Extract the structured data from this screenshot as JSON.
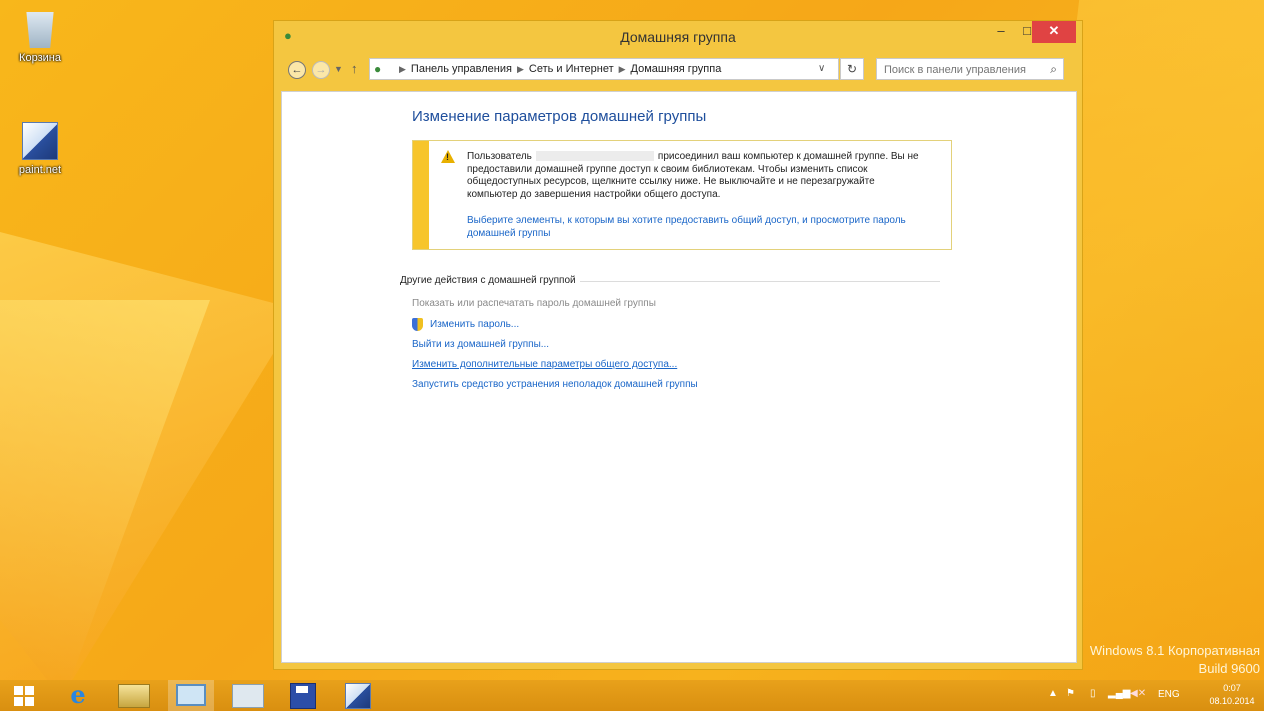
{
  "desktop": {
    "icons": [
      {
        "label": "Корзина"
      },
      {
        "label": "paint.net"
      }
    ],
    "watermark": {
      "line1": "Windows 8.1 Корпоративная",
      "line2": "Build 9600"
    }
  },
  "window": {
    "title": "Домашняя группа",
    "controls": {
      "minimize": "–",
      "maximize": "□",
      "close": "✕"
    },
    "address": {
      "breadcrumbs": [
        "Панель управления",
        "Сеть и Интернет",
        "Домашняя группа"
      ],
      "search_placeholder": "Поиск в панели управления"
    },
    "content": {
      "title": "Изменение параметров домашней группы",
      "notice": {
        "text_before": "Пользователь",
        "text_after": "присоединил ваш компьютер к домашней группе. Вы не предоставили домашней группе доступ к своим библиотекам. Чтобы изменить список общедоступных ресурсов, щелкните ссылку ниже. Не выключайте и не перезагружайте компьютер до завершения настройки общего доступа.",
        "link": "Выберите элементы, к которым вы хотите предоставить общий доступ, и просмотрите пароль домашней группы"
      },
      "other_actions": {
        "heading": "Другие действия с домашней группой",
        "show_password": "Показать или распечатать пароль домашней группы",
        "change_password": "Изменить пароль...",
        "leave": "Выйти из домашней группы...",
        "advanced_sharing": "Изменить дополнительные параметры общего доступа...",
        "troubleshoot": "Запустить средство устранения неполадок домашней группы"
      }
    }
  },
  "taskbar": {
    "language": "ENG",
    "clock": {
      "time": "0:07",
      "date": "08.10.2014"
    }
  },
  "colors": {
    "desktop_bg": "#f6a718",
    "link": "#1a66c8",
    "title_blue": "#1e4e9c",
    "close_red": "#e04343",
    "notice_bar": "#f7c52b"
  }
}
